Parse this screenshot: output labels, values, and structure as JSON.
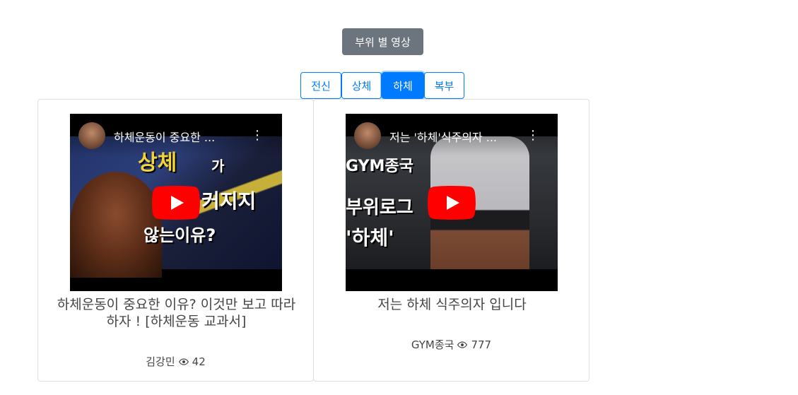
{
  "header": {
    "button_label": "부위 별 영상"
  },
  "tabs": [
    {
      "label": "전신",
      "active": false
    },
    {
      "label": "상체",
      "active": false
    },
    {
      "label": "하체",
      "active": true
    },
    {
      "label": "복부",
      "active": false
    }
  ],
  "colors": {
    "accent": "#007bff",
    "header_button": "#6c757d",
    "youtube_red": "#ff0000"
  },
  "videos": [
    {
      "embed_title": "하체운동이 중요한 ...",
      "thumbnail_text": [
        "상체",
        "가",
        "커지지",
        "않는이유?"
      ],
      "title": "하체운동이 중요한 이유? 이것만 보고 따라하자 ! [하체운동 교과서]",
      "author": "김강민",
      "views": "42",
      "view_icon": "eye-icon",
      "play_icon": "youtube-play-icon",
      "menu_icon": "more-vert-icon"
    },
    {
      "embed_title": "저는 '하체'식주의자 ...",
      "thumbnail_text": [
        "GYM종국",
        "부위로그",
        "'하체'"
      ],
      "title": "저는 하체 식주의자 입니다",
      "author": "GYM종국",
      "views": "777",
      "view_icon": "eye-icon",
      "play_icon": "youtube-play-icon",
      "menu_icon": "more-vert-icon"
    }
  ]
}
